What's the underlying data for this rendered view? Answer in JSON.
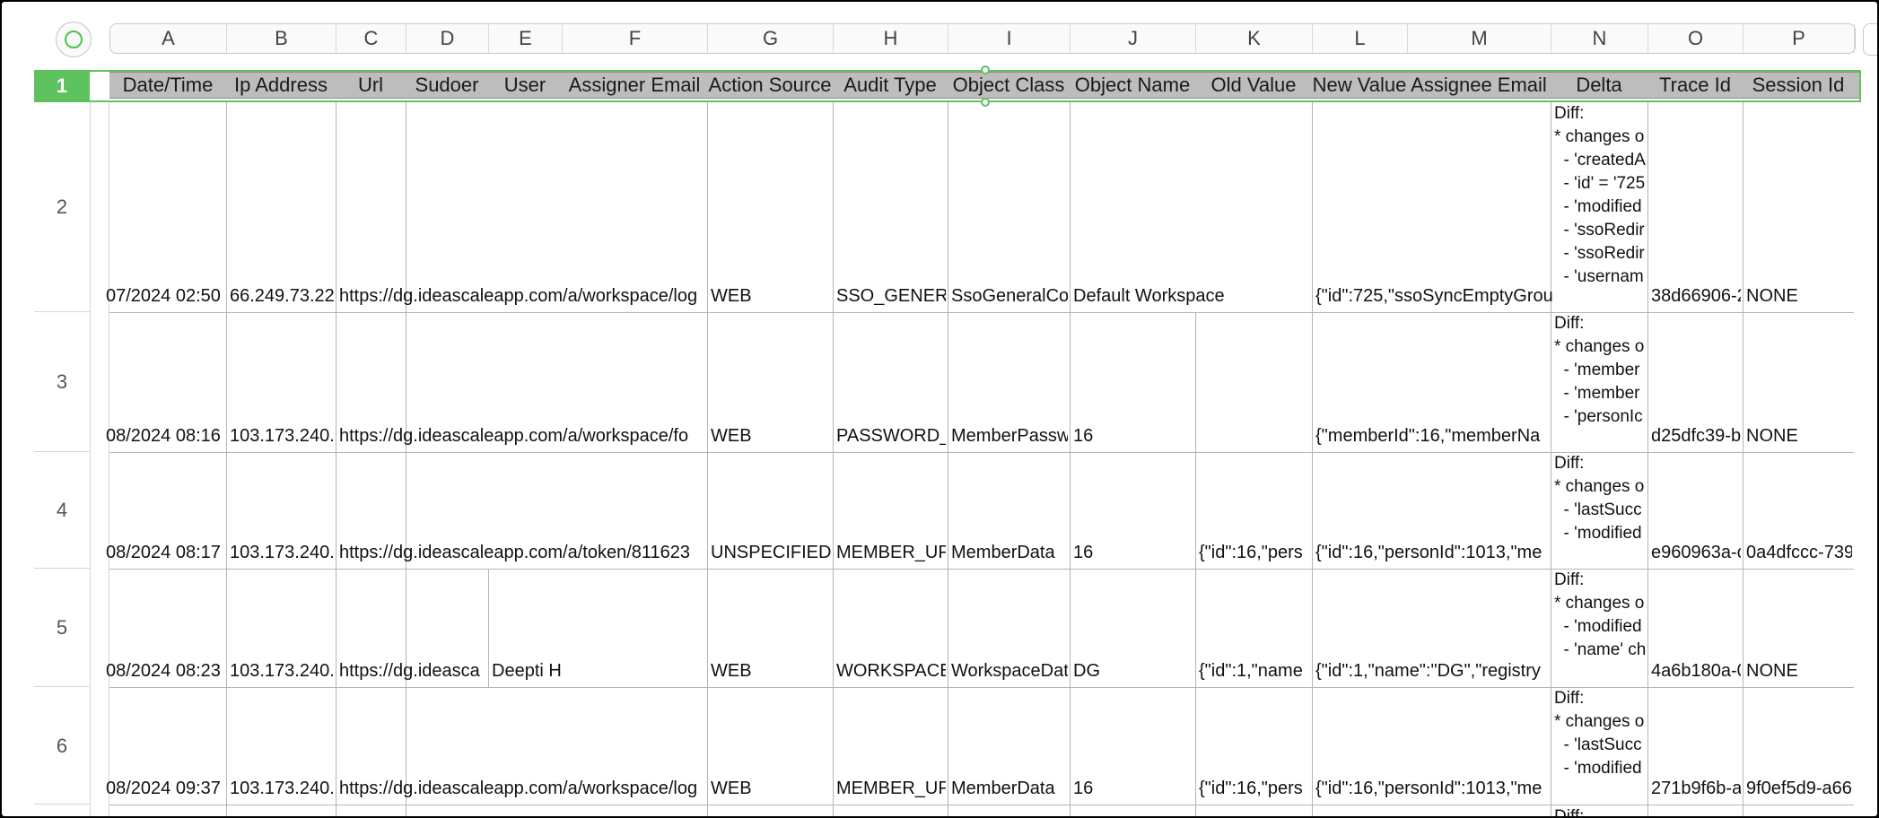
{
  "column_letters": [
    "A",
    "B",
    "C",
    "D",
    "E",
    "F",
    "G",
    "H",
    "I",
    "J",
    "K",
    "L",
    "M",
    "N",
    "O",
    "P"
  ],
  "selected_row": "1",
  "headers": [
    "Date/Time",
    "Ip Address",
    "Url",
    "Sudoer",
    "User",
    "Assigner Email",
    "Action Source",
    "Audit Type",
    "Object Class",
    "Object Name",
    "Old Value",
    "New Value",
    "Assignee Email",
    "Delta",
    "Trace Id",
    "Session Id"
  ],
  "rows": [
    {
      "num": "2",
      "date": "07/2024 02:50",
      "ip": "66.249.73.22",
      "url": "https://dg.ideascaleapp.com/a/workspace/log",
      "user": "",
      "action_source": "WEB",
      "audit_type": "SSO_GENERAL",
      "object_class": "SsoGeneralCon",
      "object_name": "Default Workspace",
      "old_value": "",
      "new_value": "{\"id\":725,\"ssoSyncEmptyGrou",
      "delta_lines": [
        "Diff:",
        "* changes o",
        "  - 'createdA",
        "  - 'id' = '725",
        "  - 'modified",
        "  - 'ssoRedir",
        "  - 'ssoRedir",
        "  - 'usernam"
      ],
      "trace_id": "38d66906-2",
      "session_id": "NONE"
    },
    {
      "num": "3",
      "date": "08/2024 08:16",
      "ip": "103.173.240.",
      "url": "https://dg.ideascaleapp.com/a/workspace/fo",
      "user": "",
      "action_source": "WEB",
      "audit_type": "PASSWORD_R",
      "object_class": "MemberPassw",
      "object_name": "16",
      "old_value": "",
      "new_value": "{\"memberId\":16,\"memberNa",
      "delta_lines": [
        "Diff:",
        "* changes o",
        "  - 'member",
        "  - 'member",
        "  - 'personIc"
      ],
      "trace_id": "d25dfc39-b",
      "session_id": "NONE"
    },
    {
      "num": "4",
      "date": "08/2024 08:17",
      "ip": "103.173.240.",
      "url": "https://dg.ideascaleapp.com/a/token/811623",
      "user": "",
      "action_source": "UNSPECIFIED",
      "audit_type": "MEMBER_UP",
      "object_class": "MemberData",
      "object_name": "16",
      "old_value": "{\"id\":16,\"pers",
      "new_value": "{\"id\":16,\"personId\":1013,\"me",
      "delta_lines": [
        "Diff:",
        "* changes o",
        "  - 'lastSucc",
        "  - 'modified"
      ],
      "trace_id": "e960963a-c",
      "session_id": "0a4dfccc-739"
    },
    {
      "num": "5",
      "date": "08/2024 08:23",
      "ip": "103.173.240.",
      "url": "https://dg.ideasca",
      "user": "Deepti H",
      "action_source": "WEB",
      "audit_type": "WORKSPACE_",
      "object_class": "WorkspaceDat",
      "object_name": "DG",
      "old_value": "{\"id\":1,\"name",
      "new_value": "{\"id\":1,\"name\":\"DG\",\"registry",
      "delta_lines": [
        "Diff:",
        "* changes o",
        "  - 'modified",
        "  - 'name' ch"
      ],
      "trace_id": "4a6b180a-0",
      "session_id": "NONE"
    },
    {
      "num": "6",
      "date": "08/2024 09:37",
      "ip": "103.173.240.",
      "url": "https://dg.ideascaleapp.com/a/workspace/log",
      "user": "",
      "action_source": "WEB",
      "audit_type": "MEMBER_UP",
      "object_class": "MemberData",
      "object_name": "16",
      "old_value": "{\"id\":16,\"pers",
      "new_value": "{\"id\":16,\"personId\":1013,\"me",
      "delta_lines": [
        "Diff:",
        "* changes o",
        "  - 'lastSucc",
        "  - 'modified"
      ],
      "trace_id": "271b9f6b-a",
      "session_id": "9f0ef5d9-a66"
    }
  ],
  "next_row_delta": "Diff:",
  "colors": {
    "selection": "#5ec25e",
    "header_bg": "#bdbdbd"
  }
}
